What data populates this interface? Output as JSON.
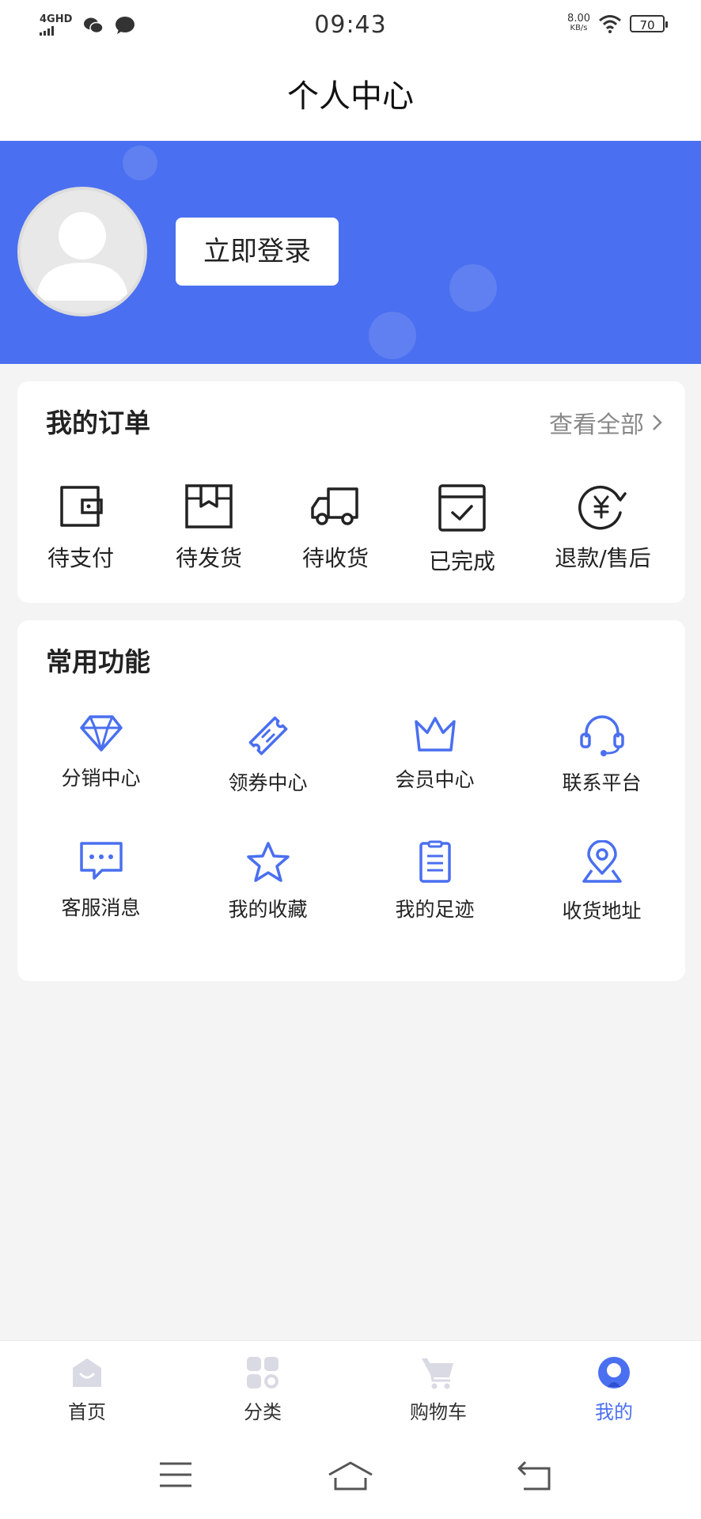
{
  "status_bar": {
    "network": "4GHD",
    "time": "09:43",
    "speed_value": "8.00",
    "speed_unit": "KB/s",
    "battery": "70"
  },
  "header": {
    "title": "个人中心"
  },
  "profile": {
    "login_button": "立即登录"
  },
  "orders": {
    "title": "我的订单",
    "view_all": "查看全部",
    "items": [
      {
        "label": "待支付",
        "icon": "wallet-icon"
      },
      {
        "label": "待发货",
        "icon": "box-icon"
      },
      {
        "label": "待收货",
        "icon": "truck-icon"
      },
      {
        "label": "已完成",
        "icon": "check-calendar-icon"
      },
      {
        "label": "退款/售后",
        "icon": "refund-yen-icon"
      }
    ]
  },
  "functions": {
    "title": "常用功能",
    "items": [
      {
        "label": "分销中心",
        "icon": "diamond-icon"
      },
      {
        "label": "领券中心",
        "icon": "coupon-icon"
      },
      {
        "label": "会员中心",
        "icon": "crown-icon"
      },
      {
        "label": "联系平台",
        "icon": "headset-icon"
      },
      {
        "label": "客服消息",
        "icon": "chat-bubble-icon"
      },
      {
        "label": "我的收藏",
        "icon": "star-icon"
      },
      {
        "label": "我的足迹",
        "icon": "document-icon"
      },
      {
        "label": "收货地址",
        "icon": "location-pin-icon"
      }
    ]
  },
  "tabbar": {
    "items": [
      {
        "label": "首页",
        "icon": "home-icon",
        "active": false
      },
      {
        "label": "分类",
        "icon": "category-icon",
        "active": false
      },
      {
        "label": "购物车",
        "icon": "cart-icon",
        "active": false
      },
      {
        "label": "我的",
        "icon": "user-icon",
        "active": true
      }
    ]
  },
  "colors": {
    "accent": "#4a6ff0",
    "icon_blue": "#4a6ff0",
    "background": "#f4f4f4"
  }
}
